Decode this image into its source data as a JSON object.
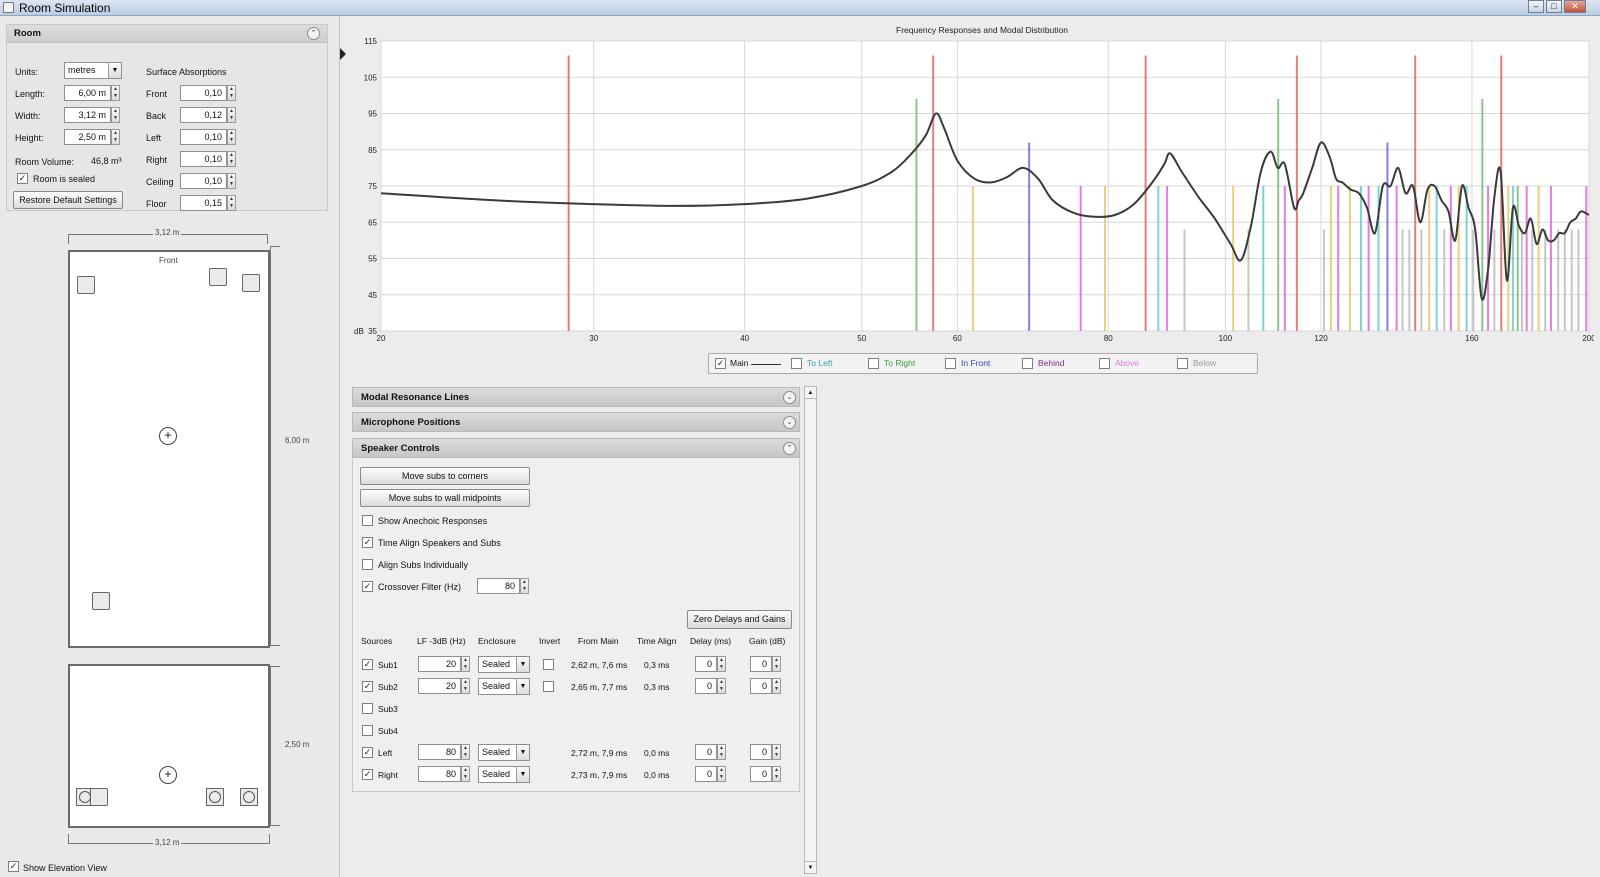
{
  "window": {
    "title": "Room Simulation",
    "minimize": "–",
    "maximize": "□",
    "close": "✕"
  },
  "room": {
    "header": "Room",
    "units_label": "Units:",
    "units_value": "metres",
    "length_label": "Length:",
    "length_value": "6,00 m",
    "width_label": "Width:",
    "width_value": "3,12 m",
    "height_label": "Height:",
    "height_value": "2,50 m",
    "volume_label": "Room Volume:",
    "volume_value": "46,8 m³",
    "sealed_label": "Room is sealed",
    "sealed_checked": true,
    "restore_button": "Restore Default Settings",
    "absorptions_title": "Surface Absorptions",
    "absorptions": [
      {
        "label": "Front",
        "value": "0,10"
      },
      {
        "label": "Back",
        "value": "0,12"
      },
      {
        "label": "Left",
        "value": "0,10"
      },
      {
        "label": "Right",
        "value": "0,10"
      },
      {
        "label": "Ceiling",
        "value": "0,10"
      },
      {
        "label": "Floor",
        "value": "0,15"
      }
    ]
  },
  "plan_view": {
    "width_dim": "3,12 m",
    "length_dim": "6,00 m",
    "front_label": "Front"
  },
  "elevation_view": {
    "width_dim": "3,12 m",
    "height_dim": "2,50 m"
  },
  "show_elevation": {
    "label": "Show Elevation View",
    "checked": true
  },
  "chart_data": {
    "type": "line",
    "title": "Frequency Responses and Modal Distribution",
    "x_scale": "log",
    "xlim": [
      20,
      200
    ],
    "ylim": [
      35,
      115
    ],
    "x_ticks": [
      20,
      30,
      40,
      50,
      60,
      80,
      100,
      120,
      160,
      200
    ],
    "y_ticks": [
      35,
      45,
      55,
      65,
      75,
      85,
      95,
      105,
      115
    ],
    "y_unit_label": "dB",
    "grid": true,
    "series": [
      {
        "name": "Main",
        "color": "#3a3a3a",
        "x": [
          20,
          25,
          30,
          35,
          40,
          45,
          50,
          53,
          55,
          56.5,
          57.6,
          58.5,
          60,
          62,
          64,
          66,
          68,
          70,
          72,
          75,
          78,
          81,
          84,
          87,
          89,
          90,
          92,
          95,
          98,
          101,
          103,
          105,
          107,
          109,
          110.5,
          112,
          114,
          115,
          116,
          118,
          120,
          122,
          123.5,
          125,
          127,
          129,
          131,
          133,
          135,
          137,
          139,
          141,
          143,
          145,
          147,
          149,
          151,
          153,
          155,
          157,
          159,
          161,
          163,
          165,
          167,
          169,
          171,
          173,
          175,
          177,
          179,
          181,
          183,
          185,
          187,
          189,
          191,
          193,
          195,
          197,
          200
        ],
        "values": [
          73,
          71,
          70,
          69.5,
          70,
          71.5,
          75,
          79,
          84,
          89,
          95,
          91,
          82,
          77,
          76,
          77.5,
          80,
          77,
          71,
          67.5,
          66.5,
          67,
          70,
          76,
          81,
          84,
          79,
          72,
          66,
          59,
          54.5,
          64,
          79,
          84.5,
          80,
          81,
          69,
          71,
          73,
          80,
          87,
          83,
          77,
          76,
          74,
          73,
          69,
          62,
          75,
          75,
          80,
          73,
          75,
          65,
          74,
          75,
          71,
          68,
          60,
          75,
          69,
          63,
          44,
          52,
          72,
          79,
          49,
          69,
          64,
          62,
          66,
          59,
          63,
          60,
          60,
          62,
          62,
          65,
          66,
          68,
          67
        ]
      }
    ],
    "modal_lines": [
      {
        "x": 28.6,
        "level": 111,
        "color": "#e06666"
      },
      {
        "x": 55.5,
        "level": 99,
        "color": "#77bb77"
      },
      {
        "x": 57.3,
        "level": 111,
        "color": "#e06666"
      },
      {
        "x": 61.8,
        "level": 75,
        "color": "#ddcc66"
      },
      {
        "x": 68.8,
        "level": 87,
        "color": "#6b6bdd"
      },
      {
        "x": 75.9,
        "level": 75,
        "color": "#dd66dd"
      },
      {
        "x": 79.5,
        "level": 75,
        "color": "#ddcc66"
      },
      {
        "x": 85.9,
        "level": 111,
        "color": "#e06666"
      },
      {
        "x": 88,
        "level": 75,
        "color": "#66cccc"
      },
      {
        "x": 89.5,
        "level": 75,
        "color": "#dd66dd"
      },
      {
        "x": 92.5,
        "level": 63,
        "color": "#bbbbbb"
      },
      {
        "x": 101.5,
        "level": 75,
        "color": "#ddcc66"
      },
      {
        "x": 104.5,
        "level": 63,
        "color": "#bbbbbb"
      },
      {
        "x": 107.5,
        "level": 75,
        "color": "#66cccc"
      },
      {
        "x": 110.6,
        "level": 99,
        "color": "#77bb77"
      },
      {
        "x": 112,
        "level": 75,
        "color": "#dd66dd"
      },
      {
        "x": 114.6,
        "level": 111,
        "color": "#e06666"
      },
      {
        "x": 120.7,
        "level": 63,
        "color": "#bbbbbb"
      },
      {
        "x": 122.3,
        "level": 75,
        "color": "#ddcc66"
      },
      {
        "x": 124,
        "level": 75,
        "color": "#dd66dd"
      },
      {
        "x": 126.8,
        "level": 75,
        "color": "#ddcc66"
      },
      {
        "x": 129.5,
        "level": 75,
        "color": "#66cccc"
      },
      {
        "x": 131.4,
        "level": 75,
        "color": "#dd66dd"
      },
      {
        "x": 133.9,
        "level": 75,
        "color": "#66cccc"
      },
      {
        "x": 136.2,
        "level": 87,
        "color": "#6b6bdd"
      },
      {
        "x": 138.6,
        "level": 75,
        "color": "#dd66dd"
      },
      {
        "x": 140.2,
        "level": 63,
        "color": "#bbbbbb"
      },
      {
        "x": 142,
        "level": 63,
        "color": "#bbbbbb"
      },
      {
        "x": 143.6,
        "level": 111,
        "color": "#e06666"
      },
      {
        "x": 145.3,
        "level": 63,
        "color": "#bbbbbb"
      },
      {
        "x": 147.5,
        "level": 75,
        "color": "#ddcc66"
      },
      {
        "x": 149.6,
        "level": 75,
        "color": "#66cccc"
      },
      {
        "x": 151.8,
        "level": 63,
        "color": "#bbbbbb"
      },
      {
        "x": 153.7,
        "level": 75,
        "color": "#dd66dd"
      },
      {
        "x": 156,
        "level": 75,
        "color": "#ddcc66"
      },
      {
        "x": 158.4,
        "level": 75,
        "color": "#66cccc"
      },
      {
        "x": 160.4,
        "level": 63,
        "color": "#bbbbbb"
      },
      {
        "x": 163.2,
        "level": 99,
        "color": "#77bb77"
      },
      {
        "x": 165,
        "level": 75,
        "color": "#dd66dd"
      },
      {
        "x": 167,
        "level": 63,
        "color": "#bbbbbb"
      },
      {
        "x": 169.2,
        "level": 111,
        "color": "#e06666"
      },
      {
        "x": 171.5,
        "level": 75,
        "color": "#ddcc66"
      },
      {
        "x": 173,
        "level": 75,
        "color": "#66cccc"
      },
      {
        "x": 174.6,
        "level": 75,
        "color": "#77bb77"
      },
      {
        "x": 176,
        "level": 63,
        "color": "#bbbbbb"
      },
      {
        "x": 177.6,
        "level": 75,
        "color": "#dd66dd"
      },
      {
        "x": 179.5,
        "level": 63,
        "color": "#bbbbbb"
      },
      {
        "x": 181.7,
        "level": 75,
        "color": "#ddcc66"
      },
      {
        "x": 184,
        "level": 63,
        "color": "#bbbbbb"
      },
      {
        "x": 186,
        "level": 75,
        "color": "#dd66dd"
      },
      {
        "x": 188.6,
        "level": 63,
        "color": "#bbbbbb"
      },
      {
        "x": 191,
        "level": 63,
        "color": "#bbbbbb"
      },
      {
        "x": 193.5,
        "level": 63,
        "color": "#bbbbbb"
      },
      {
        "x": 196,
        "level": 63,
        "color": "#bbbbbb"
      },
      {
        "x": 199,
        "level": 75,
        "color": "#dd66dd"
      }
    ]
  },
  "legend": [
    {
      "label": "Main",
      "checked": true,
      "color": "#333333"
    },
    {
      "label": "To Left",
      "checked": false,
      "color": "#3aa6b0"
    },
    {
      "label": "To Right",
      "checked": false,
      "color": "#3a9a3a"
    },
    {
      "label": "In Front",
      "checked": false,
      "color": "#3a3ab0"
    },
    {
      "label": "Behind",
      "checked": false,
      "color": "#8a2a8a"
    },
    {
      "label": "Above",
      "checked": false,
      "color": "#e07ae0"
    },
    {
      "label": "Below",
      "checked": false,
      "color": "#999999"
    }
  ],
  "accordion": {
    "modal": "Modal Resonance Lines",
    "mic": "Microphone Positions",
    "speaker": "Speaker Controls"
  },
  "speaker_controls": {
    "move_corners": "Move subs to corners",
    "move_midpoints": "Move subs to wall midpoints",
    "show_anechoic": {
      "label": "Show Anechoic Responses",
      "checked": false
    },
    "time_align": {
      "label": "Time Align Speakers and Subs",
      "checked": true
    },
    "align_subs": {
      "label": "Align Subs Individually",
      "checked": false
    },
    "crossover": {
      "label": "Crossover Filter (Hz)",
      "checked": true,
      "value": "80"
    },
    "zero_button": "Zero Delays and Gains",
    "columns": [
      "Sources",
      "LF -3dB (Hz)",
      "Enclosure",
      "Invert",
      "From Main",
      "Time Align",
      "Delay (ms)",
      "Gain (dB)"
    ],
    "sources": [
      {
        "name": "Sub1",
        "checked": true,
        "lf": "20",
        "enclosure": "Sealed",
        "invert": false,
        "from_main": "2,62 m, 7,6 ms",
        "time_align": "0,3 ms",
        "delay": "0",
        "gain": "0",
        "full": true,
        "has_invert": true
      },
      {
        "name": "Sub2",
        "checked": true,
        "lf": "20",
        "enclosure": "Sealed",
        "invert": false,
        "from_main": "2,65 m, 7,7 ms",
        "time_align": "0,3 ms",
        "delay": "0",
        "gain": "0",
        "full": true,
        "has_invert": true
      },
      {
        "name": "Sub3",
        "checked": false,
        "full": false
      },
      {
        "name": "Sub4",
        "checked": false,
        "full": false
      },
      {
        "name": "Left",
        "checked": true,
        "lf": "80",
        "enclosure": "Sealed",
        "from_main": "2,72 m, 7,9 ms",
        "time_align": "0,0 ms",
        "delay": "0",
        "gain": "0",
        "full": true,
        "has_invert": false
      },
      {
        "name": "Right",
        "checked": true,
        "lf": "80",
        "enclosure": "Sealed",
        "from_main": "2,73 m, 7,9 ms",
        "time_align": "0,0 ms",
        "delay": "0",
        "gain": "0",
        "full": true,
        "has_invert": false
      }
    ]
  }
}
